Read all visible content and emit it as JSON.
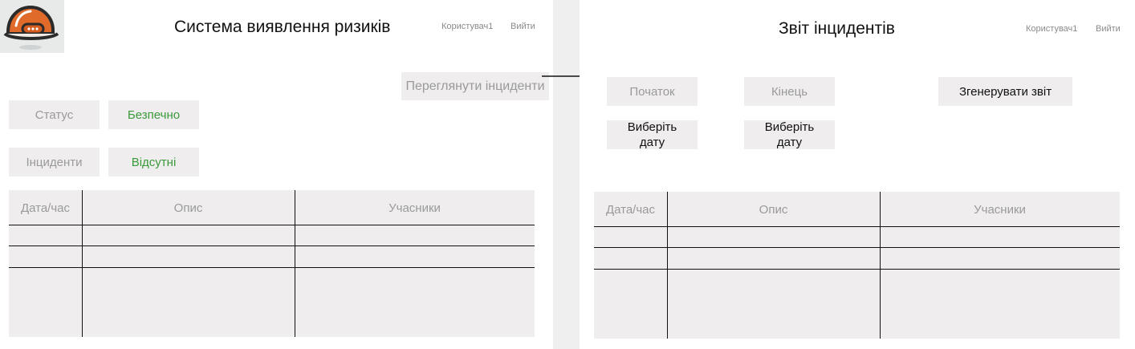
{
  "left": {
    "title": "Система виявлення ризиків",
    "user_label": "Користувач1",
    "logout_label": "Вийти",
    "view_incidents_button": "Переглянути інциденти",
    "status_label": "Статус",
    "status_value": "Безпечно",
    "incidents_label": "Інциденти",
    "incidents_value": "Відсутні",
    "table": {
      "columns": [
        "Дата/час",
        "Опис",
        "Учасники"
      ]
    }
  },
  "right": {
    "title": "Звіт інцидентів",
    "user_label": "Користувач1",
    "logout_label": "Вийти",
    "start_label": "Початок",
    "end_label": "Кінець",
    "start_date_button": "Виберіть дату",
    "end_date_button": "Виберіть дату",
    "generate_button": "Згенерувати звіт",
    "table": {
      "columns": [
        "Дата/час",
        "Опис",
        "Учасники"
      ]
    }
  },
  "colors": {
    "panel_bg": "#efeded",
    "status_green": "#3b9a3b",
    "muted_text": "#9a9a9a",
    "helmet": "#e06a2a"
  },
  "icons": {
    "logo": "hard-hat-logo-icon",
    "flow_arrow": "arrow-right-icon"
  }
}
